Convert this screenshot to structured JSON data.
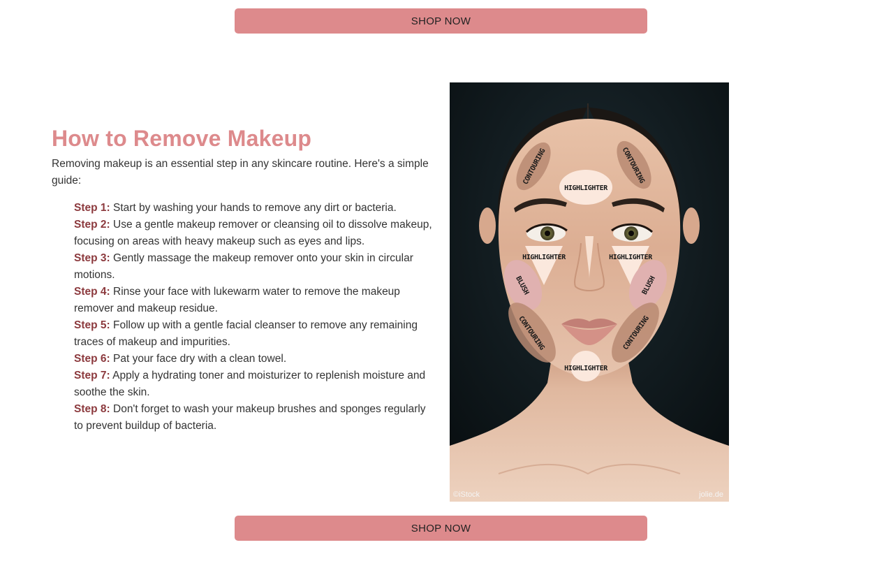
{
  "buttons": {
    "shop_top": "SHOP NOW",
    "shop_bottom": "SHOP NOW"
  },
  "article": {
    "title": "How to Remove Makeup",
    "intro": "Removing makeup is an essential step in any skincare routine. Here's a simple guide:",
    "steps": [
      {
        "label": "Step 1:",
        "text": "Start by washing your hands to remove any dirt or bacteria."
      },
      {
        "label": "Step 2:",
        "text": "Use a gentle makeup remover or cleansing oil to dissolve makeup, focusing on areas with heavy makeup such as eyes and lips."
      },
      {
        "label": "Step 3:",
        "text": "Gently massage the makeup remover onto your skin in circular motions."
      },
      {
        "label": "Step 4:",
        "text": "Rinse your face with lukewarm water to remove the makeup remover and makeup residue."
      },
      {
        "label": "Step 5:",
        "text": "Follow up with a gentle facial cleanser to remove any remaining traces of makeup and impurities."
      },
      {
        "label": "Step 6:",
        "text": "Pat your face dry with a clean towel."
      },
      {
        "label": "Step 7:",
        "text": "Apply a hydrating toner and moisturizer to replenish moisture and soothe the skin."
      },
      {
        "label": "Step 8:",
        "text": "Don't forget to wash your makeup brushes and sponges regularly to prevent buildup of bacteria."
      }
    ]
  },
  "image": {
    "zones": {
      "contour_left_top": "CONTOURING",
      "contour_right_top": "CONTOURING",
      "forehead": "HIGHLIGHTER",
      "under_eye_left": "HIGHLIGHTER",
      "under_eye_right": "HIGHLIGHTER",
      "blush_left": "BLUSH",
      "blush_right": "BLUSH",
      "contour_left_jaw": "CONTOURING",
      "contour_right_jaw": "CONTOURING",
      "chin": "HIGHLIGHTER"
    },
    "credit_left": "©iStock",
    "credit_right": "jolie.de"
  },
  "colors": {
    "accent": "#dd8a8c",
    "step_label": "#8c3a3e",
    "text": "#333333"
  }
}
